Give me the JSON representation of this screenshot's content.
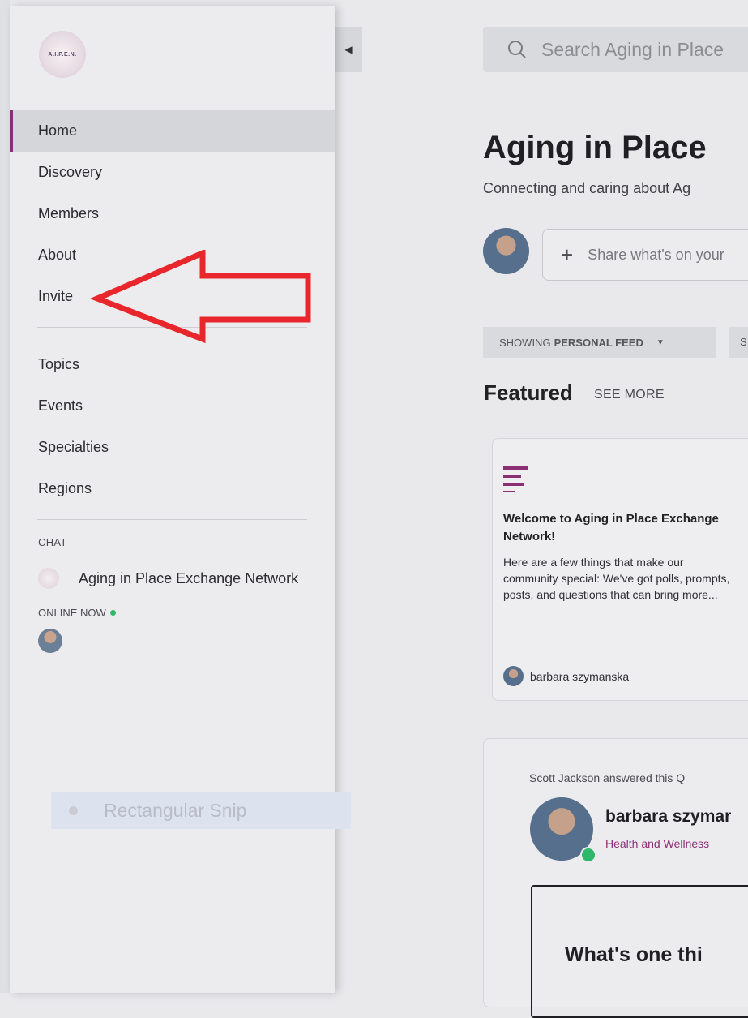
{
  "sidebar": {
    "logo_text": "A.I.P.E.N.",
    "nav_primary": [
      {
        "label": "Home",
        "active": true
      },
      {
        "label": "Discovery"
      },
      {
        "label": "Members"
      },
      {
        "label": "About"
      },
      {
        "label": "Invite"
      }
    ],
    "nav_secondary": [
      {
        "label": "Topics"
      },
      {
        "label": "Events"
      },
      {
        "label": "Specialties"
      },
      {
        "label": "Regions"
      }
    ],
    "chat_label": "CHAT",
    "chat_item": "Aging in Place Exchange Network",
    "online_label": "ONLINE NOW"
  },
  "snip": {
    "label": "Rectangular Snip"
  },
  "main": {
    "search_placeholder": "Search Aging in Place",
    "title": "Aging in Place",
    "subtitle": "Connecting and caring about Ag",
    "share_placeholder": "Share what's on your",
    "feed_prefix": "SHOWING",
    "feed_value": "PERSONAL FEED",
    "featured_label": "Featured",
    "see_more": "SEE MORE",
    "card": {
      "title": "Welcome to Aging in Place Exchange Network!",
      "body": "Here are a few things that make our community special: We've got polls, prompts, posts, and questions that can bring more...",
      "author": "barbara szymanska"
    },
    "post": {
      "meta": "Scott Jackson answered this Q",
      "author": "barbara szymar",
      "role": "Health and Wellness",
      "question": "What's one thi"
    }
  },
  "colors": {
    "accent": "#8a2f73",
    "online": "#2eb86a",
    "annotation_arrow": "#e8262b"
  }
}
